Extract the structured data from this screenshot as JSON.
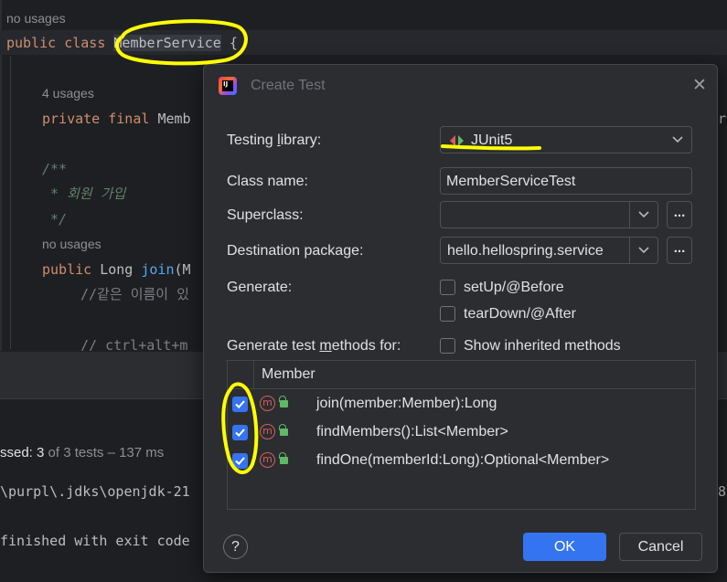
{
  "editor": {
    "usages_1": "no usages",
    "line_class_kw1": "public",
    "line_class_kw2": "class",
    "line_class_name": "MemberService",
    "line_class_brace": "{",
    "usages_2": "4 usages",
    "line_field_kw1": "private",
    "line_field_kw2": "final",
    "line_field_type": "Memb",
    "doc_open": "/**",
    "doc_body": " * 회원 가입",
    "doc_close": " */",
    "usages_3": "no usages",
    "line_method_kw": "public",
    "line_method_type": "Long",
    "line_method_name": "join",
    "line_method_paren": "(M",
    "comment_1": "//같은 이름이 있",
    "comment_2": "// ctrl+alt+m",
    "right_edge_char": "r"
  },
  "run_panel": {
    "passed_label": "ssed:",
    "passed_count": "3",
    "passed_rest": "of 3 tests – 137 ms",
    "cmd_line": "\\purpl\\.jdks\\openjdk-21",
    "cmd_tail": "a8",
    "finished_line": "finished with exit code"
  },
  "dialog": {
    "title": "Create Test",
    "testing_library_label_pre": "Testing ",
    "testing_library_label_ul": "l",
    "testing_library_label_post": "ibrary:",
    "testing_library_value": "JUnit5",
    "class_name_label": "Class name:",
    "class_name_value": "MemberServiceTest",
    "superclass_label": "Superclass:",
    "superclass_value": "",
    "destination_label": "Destination package:",
    "destination_value": "hello.hellospring.service",
    "generate_label": "Generate:",
    "setup_label": "setUp/@Before",
    "teardown_label": "tearDown/@After",
    "methods_for_pre": "Generate test ",
    "methods_for_ul": "m",
    "methods_for_post": "ethods for:",
    "show_inherited_label": "Show inherited methods",
    "table_header": "Member",
    "methods": [
      {
        "label": "join(member:Member):Long",
        "checked": true,
        "icon": "method-icon"
      },
      {
        "label": "findMembers():List<Member>",
        "checked": true,
        "icon": "method-icon"
      },
      {
        "label": "findOne(memberId:Long):Optional<Member>",
        "checked": true,
        "icon": "method-icon"
      }
    ],
    "help_label": "?",
    "ok_label": "OK",
    "cancel_label": "Cancel",
    "dots_label": "..."
  },
  "colors": {
    "accent": "#3574f0",
    "annotation": "#ffff00",
    "method_icon": "#db5c5c",
    "lock_icon": "#5fb865"
  }
}
